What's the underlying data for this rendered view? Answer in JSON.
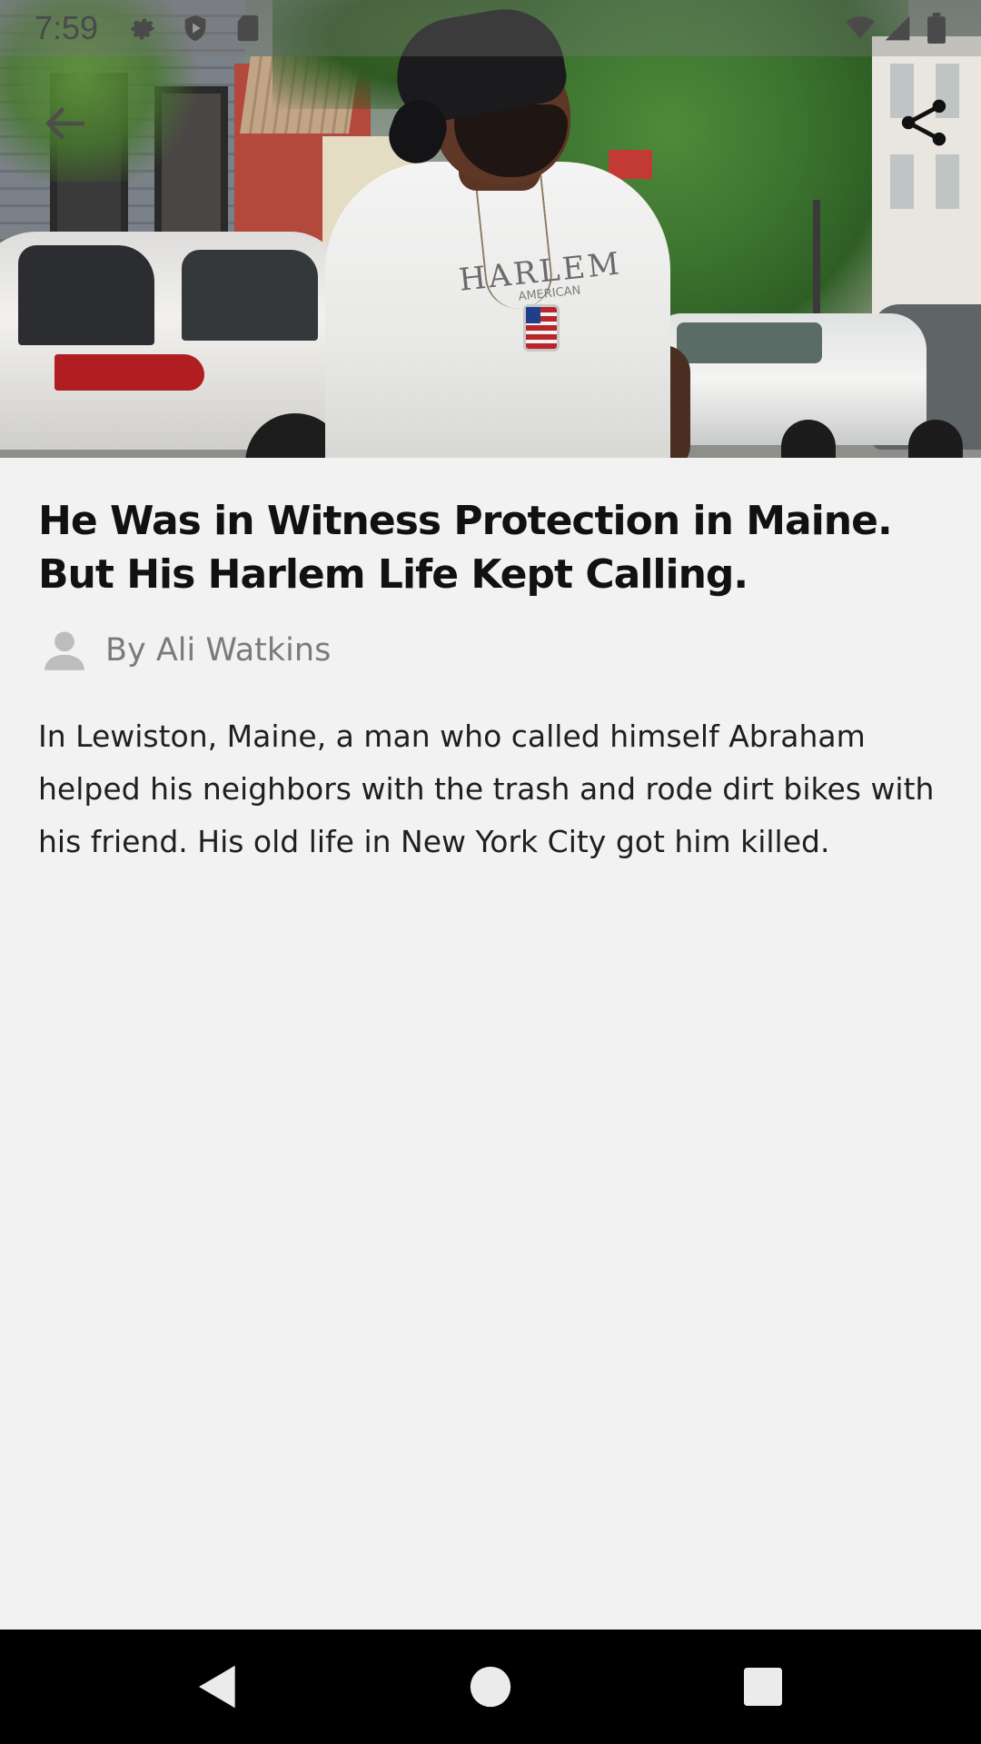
{
  "status_bar": {
    "time": "7:59",
    "icons": [
      "gear-icon",
      "shield-play-icon",
      "sd-card-icon",
      "wifi-icon",
      "signal-icon",
      "battery-icon"
    ]
  },
  "toolbar": {
    "back_icon": "arrow-back-icon",
    "share_icon": "share-icon"
  },
  "hero_image": {
    "shirt_text": "HARLEM",
    "shirt_subtext": "AMERICAN"
  },
  "article": {
    "headline": "He Was in Witness Protection in Maine. But His Harlem Life Kept Calling.",
    "byline": "By Ali Watkins",
    "summary": "In Lewiston, Maine, a man who called himself Abraham helped his neighbors with the trash and rode dirt bikes with his friend. His old life in New York City got him killed."
  },
  "nav_bar": {
    "buttons": [
      "back-triangle-icon",
      "home-circle-icon",
      "recents-square-icon"
    ]
  },
  "colors": {
    "background": "#f2f2f2",
    "headline": "#111111",
    "byline": "#7b7b7b",
    "nav_bar": "#000000"
  }
}
